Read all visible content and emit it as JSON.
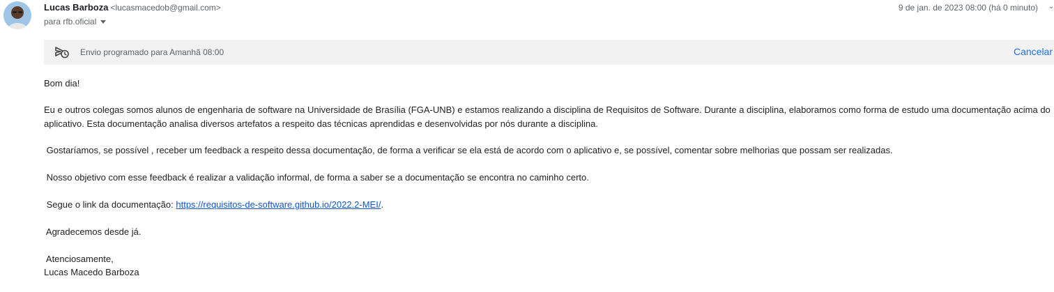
{
  "header": {
    "sender_name": "Lucas Barboza",
    "sender_email": "<lucasmacedob@gmail.com>",
    "recipient": "para rfb.oficial",
    "date": "9 de jan. de 2023 08:00 (há 0 minuto)"
  },
  "banner": {
    "icon": "schedule-send-icon",
    "text": "Envio programado para Amanhã 08:00",
    "cancel_label": "Cancelar"
  },
  "body": {
    "greeting": "Bom dia!",
    "p1_line1": "Eu e outros colegas somos alunos de engenharia de software na Universidade de Brasília (FGA-UNB) e estamos realizando a disciplina de Requisitos de Software. Durante a disciplina, elaboramos como forma de estudo uma documentação acima do",
    "p1_line2": "aplicativo. Esta documentação analisa diversos artefatos a respeito das técnicas aprendidas e desenvolvidas por nós durante a disciplina.",
    "p2": " Gostaríamos, se possível , receber um feedback a respeito dessa documentação, de forma a verificar se ela está de acordo com o aplicativo e, se possível, comentar sobre melhorias que possam ser realizadas.",
    "p3": " Nosso objetivo com esse feedback é realizar a validação informal, de forma a saber se a documentação se encontra no caminho certo.",
    "p4_prefix": " Segue o link da documentação: ",
    "p4_link": "https://requisitos-de-software.github.io/2022.2-MEI/",
    "p4_suffix": ".",
    "p5": " Agradecemos desde já.",
    "closing": " Atenciosamente,",
    "signature": "Lucas Macedo Barboza"
  }
}
